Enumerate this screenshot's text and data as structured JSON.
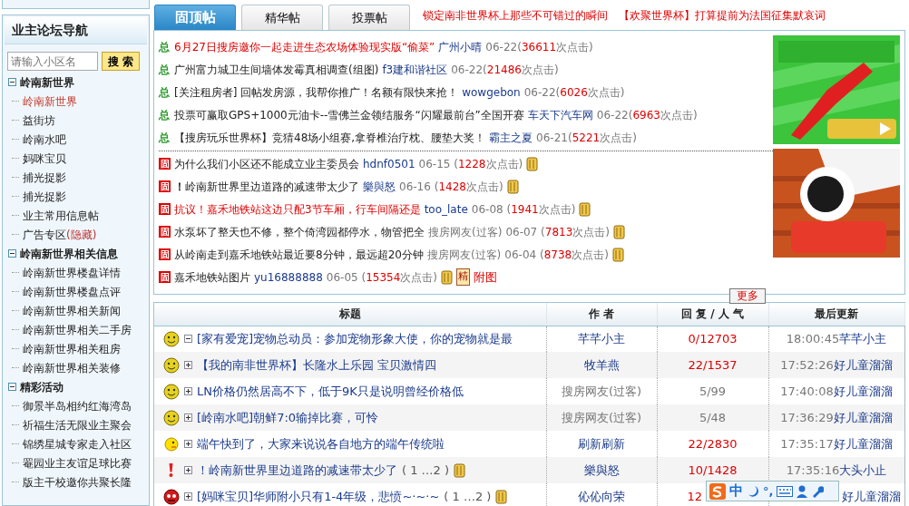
{
  "sidebar": {
    "title": "业主论坛导航",
    "search": {
      "placeholder": "请输入小区名",
      "button": "搜 索"
    },
    "groups": [
      {
        "label": "岭南新世界",
        "expanded": true,
        "children": [
          {
            "label": "岭南新世界",
            "selected": true
          },
          {
            "label": "益街坊",
            "selected": false
          },
          {
            "label": "岭南水吧",
            "selected": false
          },
          {
            "label": "妈咪宝贝",
            "selected": false
          },
          {
            "label": "捕光捉影",
            "selected": false
          },
          {
            "label": "捕光捉影",
            "selected": false
          },
          {
            "label": "业主常用信息帖",
            "selected": false
          },
          {
            "label": "广告专区",
            "tag": "(隐藏)",
            "selected": false
          }
        ]
      },
      {
        "label": "岭南新世界相关信息",
        "expanded": true,
        "children": [
          {
            "label": "岭南新世界楼盘详情",
            "selected": false
          },
          {
            "label": "岭南新世界楼盘点评",
            "selected": false
          },
          {
            "label": "岭南新世界相关新闻",
            "selected": false
          },
          {
            "label": "岭南新世界相关二手房",
            "selected": false
          },
          {
            "label": "岭南新世界相关租房",
            "selected": false
          },
          {
            "label": "岭南新世界相关装修",
            "selected": false
          }
        ]
      },
      {
        "label": "精彩活动",
        "expanded": true,
        "children": [
          {
            "label": "御景半岛相约红海湾岛",
            "selected": false
          },
          {
            "label": "祈福生活无限业主聚会",
            "selected": false
          },
          {
            "label": "锦绣星城专家走入社区",
            "selected": false
          },
          {
            "label": "罨园业主友谊足球比赛",
            "selected": false
          },
          {
            "label": "版主干校邀你共聚长隆",
            "selected": false
          }
        ]
      }
    ]
  },
  "tabs": [
    {
      "label": "固顶帖",
      "selected": true
    },
    {
      "label": "精华帖",
      "selected": false
    },
    {
      "label": "投票帖",
      "selected": false
    }
  ],
  "headlines": [
    "锁定南非世界杯上那些不可错过的瞬间",
    "【欢聚世界杯】打算提前为法国征集默哀词"
  ],
  "sticky_groups": [
    [
      {
        "mark": "总",
        "title": "6月27日搜房邀你一起走进生态农场体验现实版“偷菜”",
        "highlighted": true,
        "author": "广州小晴",
        "guest": false,
        "date": "06-22(",
        "count": "36611",
        "unit": "次点击)",
        "attachment": false
      },
      {
        "mark": "总",
        "title": "广州富力城卫生间墙体发霉真相调查(组图)",
        "highlighted": false,
        "author": "f3建和谐社区",
        "guest": false,
        "date": "06-22(",
        "count": "21486",
        "unit": "次点击)",
        "attachment": false
      },
      {
        "mark": "总",
        "title": "[关注租房者] 回帖发房源，我帮你推广！名额有限快来抢！",
        "highlighted": false,
        "author": "wowgebon",
        "guest": false,
        "date": "06-22(",
        "count": "6026",
        "unit": "次点击)",
        "attachment": false
      },
      {
        "mark": "总",
        "title": "投票可赢取GPS+1000元油卡--雪佛兰金领结服务“闪耀最前台”全国开赛",
        "highlighted": false,
        "author": "车天下汽车网",
        "guest": false,
        "date": "06-22(",
        "count": "6963",
        "unit": "次点击)",
        "attachment": false
      },
      {
        "mark": "总",
        "title": "【搜房玩乐世界杯】竞猜48场小组赛,拿脊椎治疗枕、腰垫大奖！",
        "highlighted": false,
        "author": "霸主之夏",
        "guest": false,
        "date": "06-21(",
        "count": "5221",
        "unit": "次点击)",
        "attachment": false
      }
    ],
    [
      {
        "mark": "固",
        "title": "为什么我们小区还不能成立业主委员会",
        "highlighted": false,
        "author": "hdnf0501",
        "guest": false,
        "date": "06-15 (",
        "count": "1228",
        "unit": "次点击)",
        "attachment": true
      },
      {
        "mark": "固",
        "title": "**！**岭南新世界里边道路的减速带太少了",
        "highlighted": false,
        "author": "樂與怒",
        "guest": false,
        "date": "06-16 (",
        "count": "1428",
        "unit": "次点击)",
        "attachment": true
      },
      {
        "mark": "固",
        "title": "抗议！嘉禾地铁站这边只配3节车厢，行车间隔还是",
        "highlighted": true,
        "author": "too_late",
        "guest": false,
        "date": "06-08 (",
        "count": "1941",
        "unit": "次点击)",
        "attachment": true
      },
      {
        "mark": "固",
        "title": "水泵坏了整天也不修，整个倚湾园都停水，物管把全",
        "highlighted": false,
        "author": "搜房网友(过客)",
        "guest": true,
        "date": "06-07 (",
        "count": "7813",
        "unit": "次点击)",
        "attachment": true
      },
      {
        "mark": "固",
        "title": "从岭南走到嘉禾地铁站最近要8分钟，最远超20分钟",
        "highlighted": false,
        "author": "搜房网友(过客)",
        "guest": true,
        "date": "06-04 (",
        "count": "8738",
        "unit": "次点击)",
        "attachment": true
      },
      {
        "mark": "固",
        "title": "嘉禾地铁站图片",
        "highlighted": false,
        "author": "yu16888888",
        "guest": false,
        "date": "06-05 (",
        "count": "15354",
        "unit": "次点击)",
        "attachment": true,
        "badge": "精",
        "link": "附图"
      }
    ]
  ],
  "more_button": "更多",
  "ads": [
    {
      "kind": "picture"
    },
    {
      "kind": "picture"
    }
  ],
  "table": {
    "columns": [
      "标题",
      "作 者",
      "回 复 / 人 气",
      "最后更新"
    ],
    "rows": [
      {
        "kind": "smile",
        "expanded": true,
        "title": "[家有爱宠]宠物总动员：参加宠物形象大使，你的宠物就是最",
        "attachment": false,
        "author": "芊芊小主",
        "guest": false,
        "stats": "0/12703",
        "hot": true,
        "time": "18:00:45",
        "last_user": "芊芊小主"
      },
      {
        "kind": "smile",
        "expanded": false,
        "title": "【我的南非世界杯】长隆水上乐园 宝贝激情四",
        "attachment": false,
        "author": "牧羊燕",
        "guest": false,
        "stats": "22/1537",
        "hot": true,
        "time": "17:52:26",
        "last_user": "好儿童溜溜"
      },
      {
        "kind": "smile",
        "expanded": false,
        "title": "LN价格仍然居高不下，低于9K只是说明曾经价格低",
        "attachment": false,
        "author": "搜房网友(过客)",
        "guest": true,
        "stats": "5/99",
        "hot": false,
        "time": "17:40:08",
        "last_user": "好儿童溜溜"
      },
      {
        "kind": "smile",
        "expanded": false,
        "title": "[岭南水吧]朝鲜7:0输掉比赛，可怜",
        "attachment": false,
        "author": "搜房网友(过客)",
        "guest": true,
        "stats": "5/48",
        "hot": false,
        "time": "17:36:29",
        "last_user": "好儿童溜溜"
      },
      {
        "kind": "wink",
        "expanded": false,
        "title": "端午快到了，大家来说说各自地方的端午传统啦",
        "attachment": false,
        "author": "刷新刷新",
        "guest": false,
        "stats": "22/2830",
        "hot": true,
        "time": "17:35:17",
        "last_user": "好儿童溜溜"
      },
      {
        "kind": "alert",
        "expanded": false,
        "title": "！岭南新世界里边道路的减速带太少了",
        "pages": "( 1 …2 )",
        "attachment": true,
        "author": "樂與怒",
        "guest": false,
        "stats": "10/1428",
        "hot": true,
        "time": "17:35:16",
        "last_user": "大头小止"
      },
      {
        "kind": "angry",
        "expanded": false,
        "title": "[妈咪宝贝]华师附小只有1-4年级，悲愤~·~·~",
        "pages": "( 1 …2 )",
        "attachment": true,
        "author": "伈伈向荣",
        "guest": false,
        "stats": "12",
        "hot": true,
        "last_user": "好儿童溜溜"
      }
    ]
  },
  "ime": {
    "mode": "中",
    "punct": "°,"
  }
}
